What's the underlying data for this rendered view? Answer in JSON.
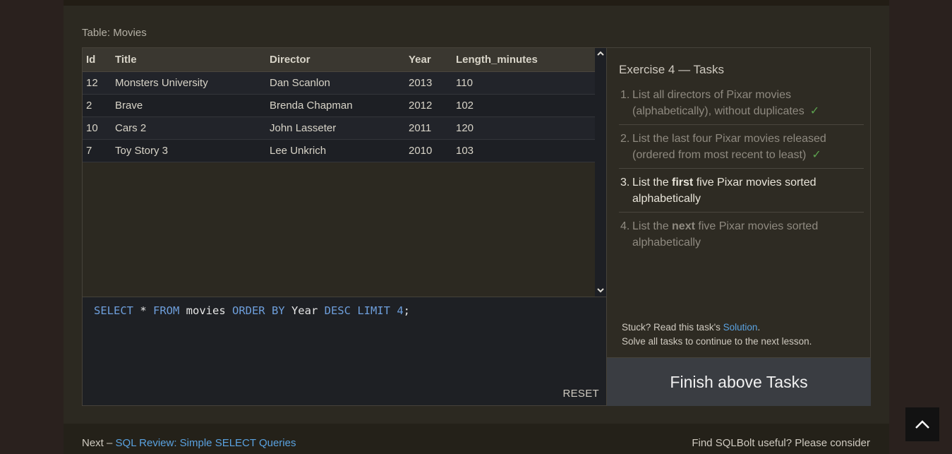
{
  "table": {
    "caption": "Table: Movies",
    "columns": [
      "Id",
      "Title",
      "Director",
      "Year",
      "Length_minutes"
    ],
    "rows": [
      [
        "12",
        "Monsters University",
        "Dan Scanlon",
        "2013",
        "110"
      ],
      [
        "2",
        "Brave",
        "Brenda Chapman",
        "2012",
        "102"
      ],
      [
        "10",
        "Cars 2",
        "John Lasseter",
        "2011",
        "120"
      ],
      [
        "7",
        "Toy Story 3",
        "Lee Unkrich",
        "2010",
        "103"
      ]
    ]
  },
  "scrollbar": {
    "up_icon": "chevron-up-icon",
    "down_icon": "chevron-down-icon"
  },
  "editor": {
    "tokens": [
      {
        "text": "SELECT",
        "kind": "keyword"
      },
      {
        "text": " * ",
        "kind": "plain"
      },
      {
        "text": "FROM",
        "kind": "keyword"
      },
      {
        "text": " movies ",
        "kind": "plain"
      },
      {
        "text": "ORDER BY",
        "kind": "keyword"
      },
      {
        "text": " Year ",
        "kind": "plain"
      },
      {
        "text": "DESC",
        "kind": "keyword"
      },
      {
        "text": " ",
        "kind": "plain"
      },
      {
        "text": "LIMIT",
        "kind": "keyword"
      },
      {
        "text": " ",
        "kind": "plain"
      },
      {
        "text": "4",
        "kind": "number"
      },
      {
        "text": ";",
        "kind": "plain"
      }
    ],
    "reset_label": "RESET"
  },
  "tasks": {
    "title": "Exercise 4 — Tasks",
    "items": [
      {
        "number": "1.",
        "before": "List all directors of Pixar movies (alphabetically), without duplicates",
        "bold": "",
        "after": "",
        "state": "done",
        "check": "✓"
      },
      {
        "number": "2.",
        "before": "List the last four Pixar movies released (ordered from most recent to least)",
        "bold": "",
        "after": "",
        "state": "done",
        "check": "✓"
      },
      {
        "number": "3.",
        "before": "List the ",
        "bold": "first",
        "after": " five Pixar movies sorted alphabetically",
        "state": "current",
        "check": ""
      },
      {
        "number": "4.",
        "before": "List the ",
        "bold": "next",
        "after": " five Pixar movies sorted alphabetically",
        "state": "pending",
        "check": ""
      }
    ],
    "stuck_prefix": "Stuck? Read this task's ",
    "solution_link": "Solution",
    "stuck_suffix": ".",
    "continue_text": "Solve all tasks to continue to the next lesson."
  },
  "finish_button": "Finish above Tasks",
  "footer": {
    "next_prefix": "Next – ",
    "next_link": "SQL Review: Simple SELECT Queries",
    "useful_text": "Find SQLBolt useful? Please consider"
  },
  "back_to_top": {
    "icon": "chevron-up-icon"
  },
  "colors": {
    "keyword": "#6e9fdc",
    "link": "#5aa2e0",
    "check": "#5ca24e",
    "background": "#2a211e"
  }
}
